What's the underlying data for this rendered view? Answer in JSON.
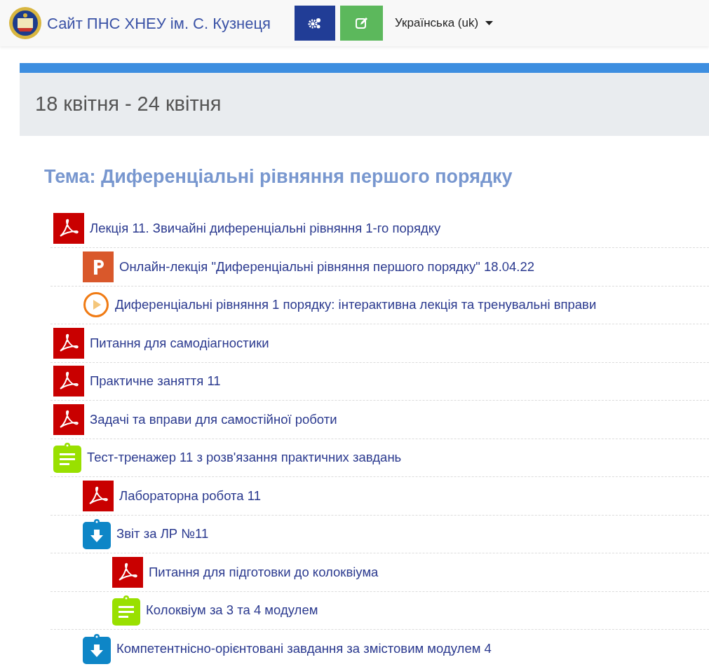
{
  "header": {
    "site_title": "Сайт ПНС ХНЕУ ім. С. Кузнеця",
    "language": "Українська (uk)"
  },
  "section": {
    "title": "18 квітня - 24 квітня",
    "topic": "Тема: Диференціальні рівняння першого порядку"
  },
  "activities": [
    {
      "kind": "pdf",
      "label": "Лекція 11. Звичайні диференціальні рівняння 1-го порядку",
      "children": [
        {
          "kind": "slides",
          "label": "Онлайн-лекція \"Диференціальні рівняння першого порядку\" 18.04.22"
        },
        {
          "kind": "interactive",
          "label": "Диференціальні рівняння 1 порядку: інтерактивна лекція та тренувальні вправи"
        }
      ]
    },
    {
      "kind": "pdf",
      "label": "Питання для самодіагностики"
    },
    {
      "kind": "pdf",
      "label": "Практичне заняття 11"
    },
    {
      "kind": "pdf",
      "label": "Задачі та вправи для самостійної роботи"
    },
    {
      "kind": "quiz",
      "label": "Тест-тренажер 11 з розв'язання практичних завдань",
      "children": [
        {
          "kind": "pdf",
          "label": "Лабораторна робота 11"
        },
        {
          "kind": "assignment",
          "label": "Звіт за ЛР №11",
          "children": [
            {
              "kind": "pdf",
              "label": "Питання для підготовки до колоквіума"
            },
            {
              "kind": "quiz",
              "label": "Колоквіум за 3 та 4 модулем"
            }
          ]
        },
        {
          "kind": "assignment",
          "label": "Компетентнісно-орієнтовані завдання за змістовим модулем 4"
        }
      ]
    }
  ]
}
